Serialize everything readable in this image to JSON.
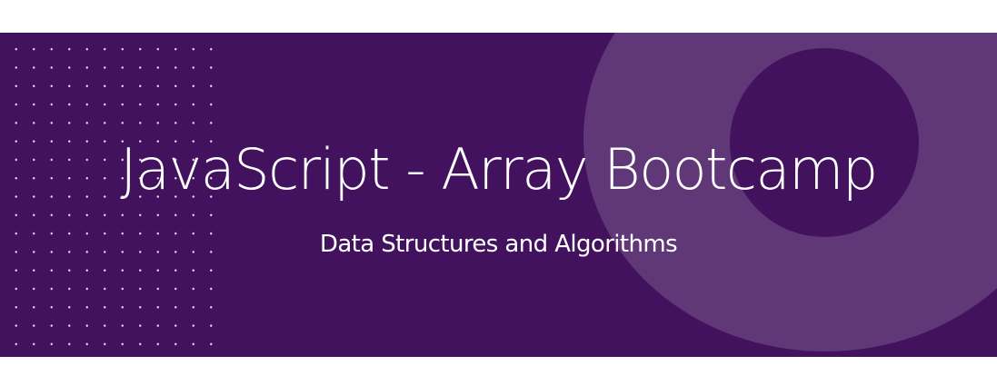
{
  "banner": {
    "title": "JavaScript - Array Bootcamp",
    "subtitle": "Data Structures and Algorithms",
    "colors": {
      "background": "#43125f",
      "ring": "#603877",
      "text": "#ffffff",
      "dots": "#ffffff"
    }
  }
}
